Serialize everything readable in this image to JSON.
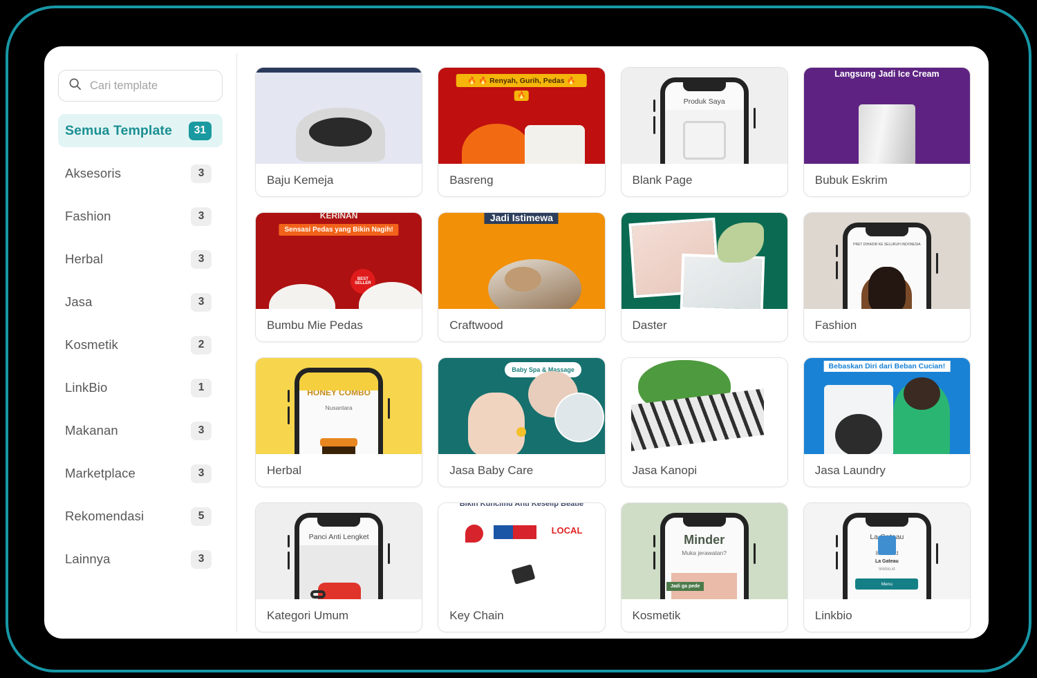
{
  "theme": {
    "frame_border": "#1797a6",
    "accent": "#1a9aa0",
    "active_bg": "#e2f5f4",
    "panel_bg": "#ffffff"
  },
  "search": {
    "placeholder": "Cari template",
    "value": "",
    "icon": "search-icon"
  },
  "sidebar": {
    "items": [
      {
        "label": "Semua Template",
        "count": "31",
        "active": true
      },
      {
        "label": "Aksesoris",
        "count": "3",
        "active": false
      },
      {
        "label": "Fashion",
        "count": "3",
        "active": false
      },
      {
        "label": "Herbal",
        "count": "3",
        "active": false
      },
      {
        "label": "Jasa",
        "count": "3",
        "active": false
      },
      {
        "label": "Kosmetik",
        "count": "2",
        "active": false
      },
      {
        "label": "LinkBio",
        "count": "1",
        "active": false
      },
      {
        "label": "Makanan",
        "count": "3",
        "active": false
      },
      {
        "label": "Marketplace",
        "count": "3",
        "active": false
      },
      {
        "label": "Rekomendasi",
        "count": "5",
        "active": false
      },
      {
        "label": "Lainnya",
        "count": "3",
        "active": false
      }
    ]
  },
  "templates": [
    {
      "label": "Baju Kemeja",
      "thumb_bg": "#e4e6f2",
      "top_band": "#2b3a5c",
      "banner_text": "",
      "phone_title": ""
    },
    {
      "label": "Basreng",
      "thumb_bg": "#bf0f0f",
      "banner_text": "Renyah, Gurih, Pedas",
      "banner_bg": "#f5b50a",
      "banner_color": "#4a2c00"
    },
    {
      "label": "Blank Page",
      "thumb_bg": "#efefef",
      "phone_title": "Produk Saya"
    },
    {
      "label": "Bubuk Eskrim",
      "thumb_bg": "#5e2382",
      "banner_text": "Langsung Jadi Ice Cream",
      "banner_color": "#ffffff"
    },
    {
      "label": "Bumbu Mie Pedas",
      "thumb_bg": "#ad1111",
      "overline_text": "KERINAN",
      "banner_text": "Sensasi Pedas yang Bikin Nagih!",
      "banner_bg": "#f2621a",
      "banner_color": "#ffffff",
      "badge_text": "BEST SELLER"
    },
    {
      "label": "Craftwood",
      "thumb_bg": "#f29007",
      "banner_text": "Jadi Istimewa",
      "banner_bg": "#2c3e5c",
      "banner_color": "#ffffff"
    },
    {
      "label": "Daster",
      "thumb_bg": "#0b6b52"
    },
    {
      "label": "Fashion",
      "thumb_bg": "#ddd7cf",
      "phone_title": "PRET DIHADIR KE SELURUH INDONESIA"
    },
    {
      "label": "Herbal",
      "thumb_bg": "#f7d64e",
      "phone_title": "HONEY COMBO",
      "phone_subtitle": "Nusantara"
    },
    {
      "label": "Jasa Baby Care",
      "thumb_bg": "#16706e",
      "bubble_text": "Baby Spa & Massage"
    },
    {
      "label": "Jasa Kanopi",
      "thumb_bg": "#ffffff"
    },
    {
      "label": "Jasa Laundry",
      "thumb_bg": "#1a82d4",
      "banner_text": "Bebaskan Diri dari Beban Cucian!",
      "banner_bg": "#ffffff",
      "banner_color": "#1a82d4"
    },
    {
      "label": "Kategori Umum",
      "thumb_bg": "#efefef",
      "phone_title": "Panci Anti Lengket"
    },
    {
      "label": "Key Chain",
      "thumb_bg": "#ffffff",
      "overline_text": "Bikin Kuncimu Anti Keselip Beatle",
      "logo_text": "LOCAL"
    },
    {
      "label": "Kosmetik",
      "thumb_bg": "#cfdcc6",
      "phone_title": "Minder",
      "phone_subtitle": "Muka jerawatan?",
      "badge_text": "Jadi ga pede"
    },
    {
      "label": "Linkbio",
      "thumb_bg": "#f4f4f4",
      "phone_title": "La Gateau",
      "phone_subtitle": "linkbio.id",
      "button_text": "Menu"
    }
  ]
}
